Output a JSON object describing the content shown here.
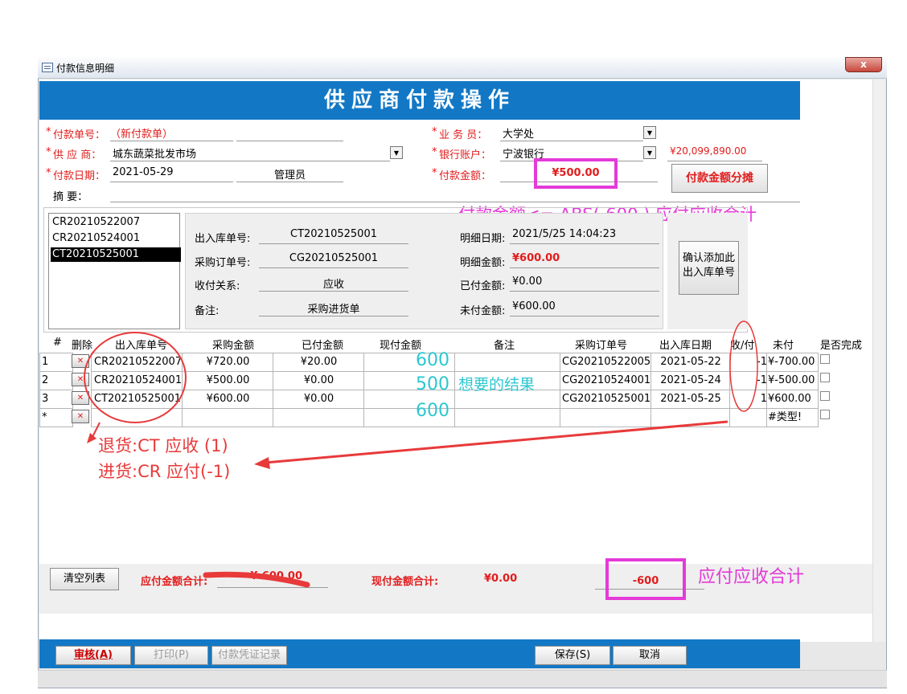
{
  "window": {
    "title": "付款信息明细",
    "close_label": "x"
  },
  "banner": {
    "title": "供应商付款操作"
  },
  "header": {
    "payment_no_label": "付款单号：",
    "payment_no_value": "（新付款单）",
    "supplier_label": "供 应 商：",
    "supplier_value": "城东蔬菜批发市场",
    "pay_date_label": "付款日期：",
    "pay_date_value": "2021-05-29",
    "operator_value": "管理员",
    "summary_label": "摘    要：",
    "salesman_label": "业 务 员：",
    "salesman_value": "大学处",
    "bank_label": "银行账户：",
    "bank_value": "宁波银行",
    "bank_balance": "¥20,099,890.00",
    "pay_amount_label": "付款金额：",
    "pay_amount_value": "¥500.00",
    "allocate_button": "付款金额分摊"
  },
  "annotations": {
    "top_note": "付款金额<= ABS(-600 ) 应付应收合计",
    "ct_note": "退货:CT  应收 (1)",
    "cr_note": "进货:CR 应付(-1)",
    "bottom_note": "应付应收合计",
    "wanted_result": "想要的结果",
    "wanted_values": [
      "600",
      "500",
      "600"
    ]
  },
  "order_list": {
    "items": [
      "CR20210522007",
      "CR20210524001",
      "CT20210525001"
    ],
    "selected_index": 2
  },
  "detail": {
    "in_out_no_label": "出入库单号:",
    "in_out_no_value": "CT20210525001",
    "purchase_order_label": "采购订单号:",
    "purchase_order_value": "CG20210525001",
    "relation_label": "收付关系:",
    "relation_value": "应收",
    "remark_label": "备注:",
    "remark_value": "采购进货单",
    "detail_date_label": "明细日期:",
    "detail_date_value": "2021/5/25 14:04:23",
    "detail_amount_label": "明细金额:",
    "detail_amount_value": "¥600.00",
    "paid_amount_label": "已付金额:",
    "paid_amount_value": "¥0.00",
    "unpaid_amount_label": "未付金额:",
    "unpaid_amount_value": "¥600.00",
    "confirm_button": "确认添加此出入库单号"
  },
  "grid": {
    "columns": [
      "#",
      "删除",
      "出入库单号",
      "采购金额",
      "已付金额",
      "现付金额",
      "备注",
      "采购订单号",
      "出入库日期",
      "收/付",
      "未付",
      "是否完成"
    ],
    "rows": [
      {
        "idx": "1",
        "no": "CR20210522007",
        "purchase": "¥720.00",
        "paid": "¥20.00",
        "current": "",
        "remark": "",
        "po": "CG20210522005",
        "date": "2021-05-22",
        "dir": "-1",
        "unpaid": "¥-700.00"
      },
      {
        "idx": "2",
        "no": "CR20210524001",
        "purchase": "¥500.00",
        "paid": "¥0.00",
        "current": "",
        "remark": "",
        "po": "CG20210524001",
        "date": "2021-05-24",
        "dir": "-1",
        "unpaid": "¥-500.00"
      },
      {
        "idx": "3",
        "no": "CT20210525001",
        "purchase": "¥600.00",
        "paid": "¥0.00",
        "current": "",
        "remark": "",
        "po": "CG20210525001",
        "date": "2021-05-25",
        "dir": "1",
        "unpaid": "¥600.00"
      }
    ],
    "new_row": {
      "idx": "*",
      "unpaid": "#类型!"
    }
  },
  "totals": {
    "clear_button": "清空列表",
    "payable_total_label": "应付金额合计:",
    "payable_total_value": "¥-600.00",
    "current_total_label": "现付金额合计:",
    "current_total_value": "¥0.00",
    "net_total_value": "-600"
  },
  "footer": {
    "approve": "审核(A)",
    "print": "打印(P)",
    "voucher": "付款凭证记录",
    "save": "保存(S)",
    "cancel": "取消"
  },
  "colors": {
    "banner": "#1278c6",
    "annotation": "#e43ad8",
    "required": "#e11111",
    "marker": "#e83a3a",
    "cyan": "#2ec7d1"
  }
}
